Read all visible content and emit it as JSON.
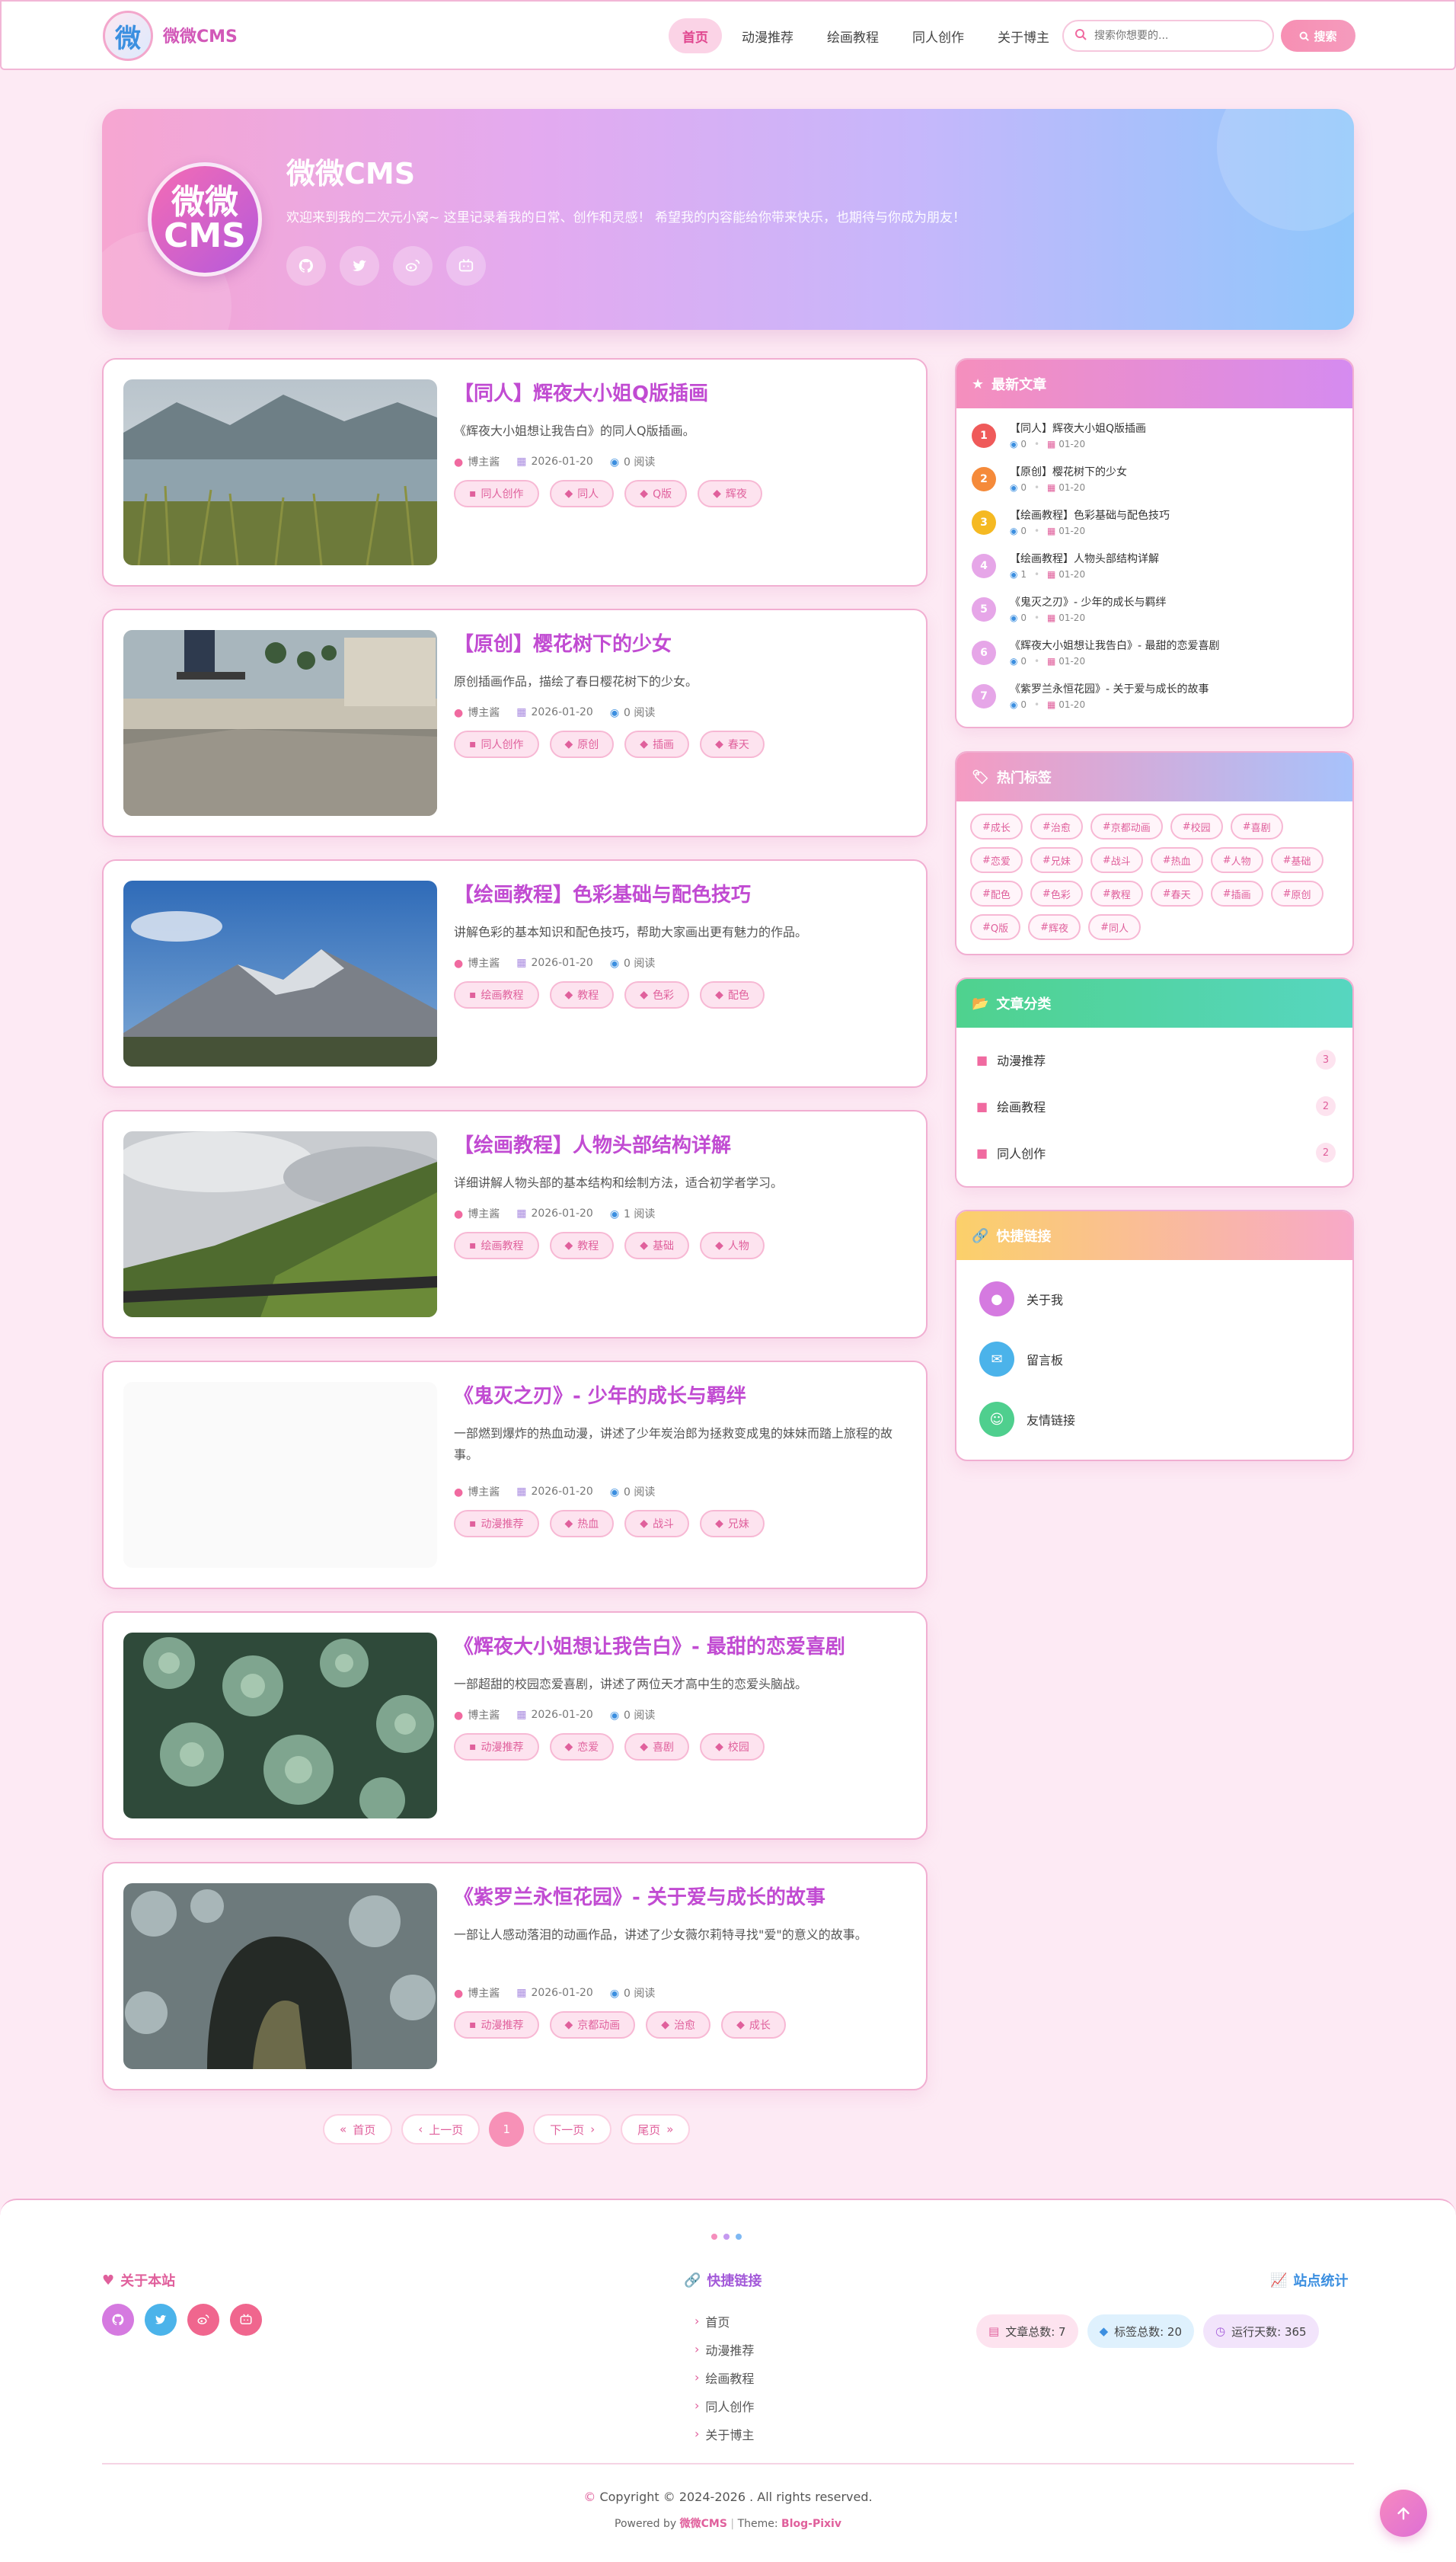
{
  "site": {
    "logo_char": "微",
    "name": "微微CMS"
  },
  "nav": [
    "首页",
    "动漫推荐",
    "绘画教程",
    "同人创作",
    "关于博主"
  ],
  "search": {
    "placeholder": "搜索你想要的...",
    "button": "搜索"
  },
  "hero": {
    "avatar_line1": "微微",
    "avatar_line2": "CMS",
    "title": "微微CMS",
    "desc": "欢迎来到我的二次元小窝~ 这里记录着我的日常、创作和灵感！ 希望我的内容能给你带来快乐，也期待与你成为朋友！",
    "social_icons": [
      "github-icon",
      "twitter-icon",
      "weibo-icon",
      "bilibili-icon"
    ]
  },
  "posts": [
    {
      "title": "【同人】辉夜大小姐Q版插画",
      "excerpt": "《辉夜大小姐想让我告白》的同人Q版插画。",
      "author": "博主酱",
      "date": "2026-01-20",
      "views": "0 阅读",
      "tags": [
        "同人创作",
        "同人",
        "Q版",
        "辉夜"
      ],
      "image": "lake"
    },
    {
      "title": "【原创】樱花树下的少女",
      "excerpt": "原创插画作品，描绘了春日樱花树下的少女。",
      "author": "博主酱",
      "date": "2026-01-20",
      "views": "0 阅读",
      "tags": [
        "同人创作",
        "原创",
        "插画",
        "春天"
      ],
      "image": "skate"
    },
    {
      "title": "【绘画教程】色彩基础与配色技巧",
      "excerpt": "讲解色彩的基本知识和配色技巧，帮助大家画出更有魅力的作品。",
      "author": "博主酱",
      "date": "2026-01-20",
      "views": "0 阅读",
      "tags": [
        "绘画教程",
        "教程",
        "色彩",
        "配色"
      ],
      "image": "mountain"
    },
    {
      "title": "【绘画教程】人物头部结构详解",
      "excerpt": "详细讲解人物头部的基本结构和绘制方法，适合初学者学习。",
      "author": "博主酱",
      "date": "2026-01-20",
      "views": "1 阅读",
      "tags": [
        "绘画教程",
        "教程",
        "基础",
        "人物"
      ],
      "image": "valley"
    },
    {
      "title": "《鬼灭之刃》- 少年的成长与羁绊",
      "excerpt": "一部燃到爆炸的热血动漫，讲述了少年炭治郎为拯救变成鬼的妹妹而踏上旅程的故事。",
      "author": "博主酱",
      "date": "2026-01-20",
      "views": "0 阅读",
      "tags": [
        "动漫推荐",
        "热血",
        "战斗",
        "兄妹"
      ],
      "image": "blank"
    },
    {
      "title": "《辉夜大小姐想让我告白》- 最甜的恋爱喜剧",
      "excerpt": "一部超甜的校园恋爱喜剧，讲述了两位天才高中生的恋爱头脑战。",
      "author": "博主酱",
      "date": "2026-01-20",
      "views": "0 阅读",
      "tags": [
        "动漫推荐",
        "恋爱",
        "喜剧",
        "校园"
      ],
      "image": "succulent"
    },
    {
      "title": "《紫罗兰永恒花园》- 关于爱与成长的故事",
      "excerpt": "一部让人感动落泪的动画作品，讲述了少女薇尔莉特寻找\"爱\"的意义的故事。",
      "author": "博主酱",
      "date": "2026-01-20",
      "views": "0 阅读",
      "tags": [
        "动漫推荐",
        "京都动画",
        "治愈",
        "成长"
      ],
      "image": "rock"
    }
  ],
  "pager": {
    "first": "首页",
    "prev": "上一页",
    "current": "1",
    "next": "下一页",
    "last": "尾页"
  },
  "latest": {
    "title": "最新文章",
    "items": [
      {
        "rank": "1",
        "title": "【同人】辉夜大小姐Q版插画",
        "views": "0",
        "date": "01-20",
        "color": "#ef5a5a"
      },
      {
        "rank": "2",
        "title": "【原创】樱花树下的少女",
        "views": "0",
        "date": "01-20",
        "color": "#f58a3a"
      },
      {
        "rank": "3",
        "title": "【绘画教程】色彩基础与配色技巧",
        "views": "0",
        "date": "01-20",
        "color": "#f5b922"
      },
      {
        "rank": "4",
        "title": "【绘画教程】人物头部结构详解",
        "views": "1",
        "date": "01-20",
        "color": "#e6a6e8"
      },
      {
        "rank": "5",
        "title": "《鬼灭之刃》- 少年的成长与羁绊",
        "views": "0",
        "date": "01-20",
        "color": "#e6a6e8"
      },
      {
        "rank": "6",
        "title": "《辉夜大小姐想让我告白》- 最甜的恋爱喜剧",
        "views": "0",
        "date": "01-20",
        "color": "#e6a6e8"
      },
      {
        "rank": "7",
        "title": "《紫罗兰永恒花园》- 关于爱与成长的故事",
        "views": "0",
        "date": "01-20",
        "color": "#e6a6e8"
      }
    ]
  },
  "hot_tags": {
    "title": "热门标签",
    "items": [
      "成长",
      "治愈",
      "京都动画",
      "校园",
      "喜剧",
      "恋爱",
      "兄妹",
      "战斗",
      "热血",
      "人物",
      "基础",
      "配色",
      "色彩",
      "教程",
      "春天",
      "插画",
      "原创",
      "Q版",
      "辉夜",
      "同人"
    ]
  },
  "categories": {
    "title": "文章分类",
    "items": [
      {
        "name": "动漫推荐",
        "count": "3"
      },
      {
        "name": "绘画教程",
        "count": "2"
      },
      {
        "name": "同人创作",
        "count": "2"
      }
    ]
  },
  "quick": {
    "title": "快捷链接",
    "items": [
      {
        "label": "关于我",
        "icon": "user-icon",
        "color": "#d57ae0"
      },
      {
        "label": "留言板",
        "icon": "comment-icon",
        "color": "#4bb3ea"
      },
      {
        "label": "友情链接",
        "icon": "users-icon",
        "color": "#4fcf8e"
      }
    ]
  },
  "footer": {
    "about_title": "关于本站",
    "links_title": "快捷链接",
    "links": [
      "首页",
      "动漫推荐",
      "绘画教程",
      "同人创作",
      "关于博主"
    ],
    "stats_title": "站点统计",
    "stats": [
      {
        "label": "文章总数: 7",
        "bg": "#fde3ef",
        "ic": "#e0609c"
      },
      {
        "label": "标签总数: 20",
        "bg": "#dff1fd",
        "ic": "#3c8fe0"
      },
      {
        "label": "运行天数: 365",
        "bg": "#f2e4fb",
        "ic": "#a35ad9"
      }
    ],
    "copyright": "Copyright © 2024-2026 . All rights reserved.",
    "powered_by": "Powered by",
    "powered_name": "微微CMS",
    "theme_label": "Theme:",
    "theme_name": "Blog-Pixiv"
  },
  "colors": {
    "accent": "#e0609c",
    "title": "#c14bd2",
    "bg": "#fdeaf4"
  }
}
